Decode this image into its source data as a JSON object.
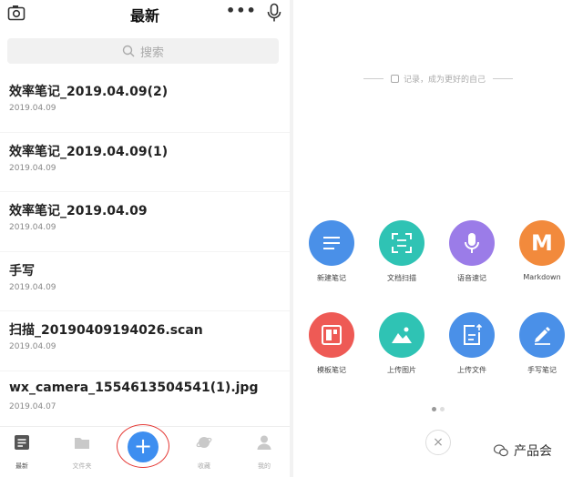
{
  "left": {
    "header": {
      "title": "最新",
      "more_label": "•••",
      "camera_icon": "camera-icon",
      "mic_icon": "microphone-icon"
    },
    "search": {
      "placeholder": "搜索"
    },
    "notes": [
      {
        "title": "效率笔记_2019.04.09(2)",
        "date": "2019.04.09"
      },
      {
        "title": "效率笔记_2019.04.09(1)",
        "date": "2019.04.09"
      },
      {
        "title": "效率笔记_2019.04.09",
        "date": "2019.04.09"
      },
      {
        "title": "手写",
        "date": "2019.04.09"
      },
      {
        "title": "扫描_20190409194026.scan",
        "date": "2019.04.09"
      },
      {
        "title": "wx_camera_1554613504541(1).jpg",
        "date": "2019.04.07"
      }
    ],
    "tabs": [
      {
        "label": "最新"
      },
      {
        "label": "文件夹"
      },
      {
        "label": "收藏"
      },
      {
        "label": "我的"
      }
    ],
    "fab_label": "+"
  },
  "right": {
    "slogan": "记录，成为更好的自己",
    "actions": [
      {
        "label": "新建笔记",
        "color": "#4a90e8",
        "icon": "note-lines-icon"
      },
      {
        "label": "文档扫描",
        "color": "#2fc3b4",
        "icon": "scan-icon"
      },
      {
        "label": "语音速记",
        "color": "#9b7ce8",
        "icon": "microphone-icon"
      },
      {
        "label": "Markdown",
        "color": "#f28a3c",
        "glyph": "M",
        "icon": "markdown-icon"
      },
      {
        "label": "模板笔记",
        "color": "#ee5a55",
        "icon": "template-icon"
      },
      {
        "label": "上传图片",
        "color": "#2fc3b4",
        "icon": "image-icon"
      },
      {
        "label": "上传文件",
        "color": "#4a90e8",
        "icon": "file-upload-icon"
      },
      {
        "label": "手写笔记",
        "color": "#4a90e8",
        "icon": "pen-icon"
      }
    ],
    "close_label": "×",
    "watermark": "产品会"
  },
  "colors": {
    "accent": "#3d8ef0",
    "highlight_ring": "#e53935"
  }
}
